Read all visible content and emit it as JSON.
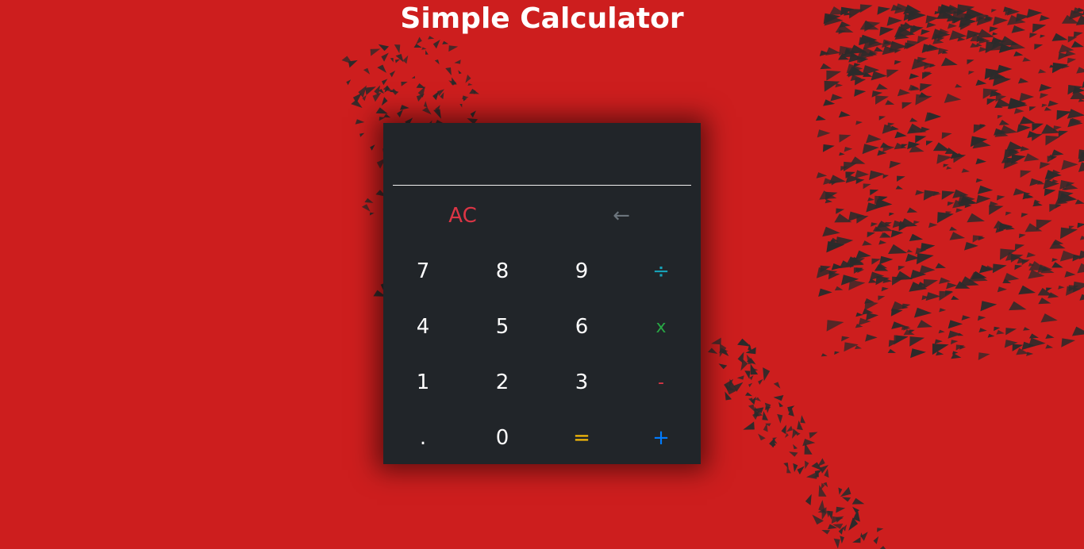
{
  "page": {
    "title": "Simple Calculator"
  },
  "calculator": {
    "display_value": "",
    "keys": {
      "clear": "AC",
      "backspace": "←",
      "seven": "7",
      "eight": "8",
      "nine": "9",
      "divide": "÷",
      "four": "4",
      "five": "5",
      "six": "6",
      "multiply": "x",
      "one": "1",
      "two": "2",
      "three": "3",
      "subtract": "-",
      "decimal": ".",
      "zero": "0",
      "equals": "=",
      "add": "+"
    }
  },
  "colors": {
    "background": "#cd1e1e",
    "panel": "#212529",
    "clear": "#dc3545",
    "backspace": "#6c757d",
    "divide": "#17a2b8",
    "multiply": "#28a745",
    "subtract": "#dc3545",
    "equals": "#ffc107",
    "add": "#007bff"
  }
}
